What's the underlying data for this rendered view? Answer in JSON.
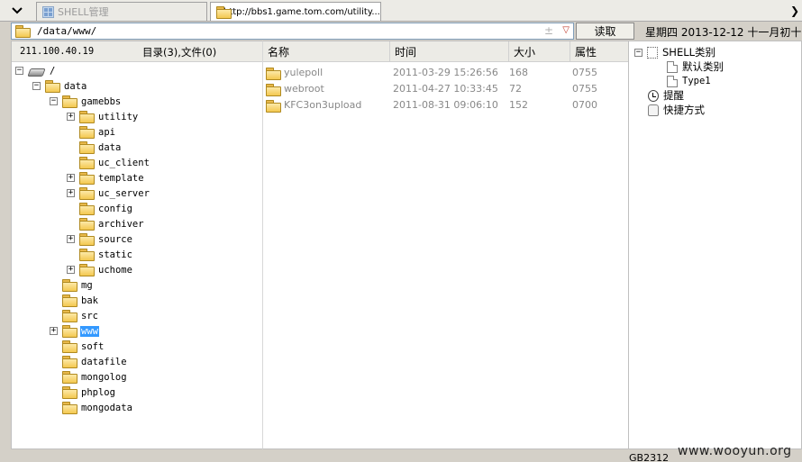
{
  "tabs": [
    {
      "label": "SHELL管理",
      "active": false
    },
    {
      "label": "http://bbs1.game.tom.com/utility...",
      "active": true
    }
  ],
  "address": {
    "path": "/data/www/",
    "read_label": "读取",
    "date": "星期四 2013-12-12 十一月初十"
  },
  "left_header": {
    "ip": "211.100.40.19",
    "summary": "目录(3),文件(0)"
  },
  "tree": {
    "root": "/",
    "data": "data",
    "gamebbs": "gamebbs",
    "gamebbs_children": [
      "utility",
      "api",
      "data",
      "uc_client",
      "template",
      "uc_server",
      "config",
      "archiver",
      "source",
      "static",
      "uchome"
    ],
    "data_children": [
      "mg",
      "bak",
      "src",
      "www",
      "soft",
      "datafile",
      "mongolog",
      "phplog",
      "mongodata"
    ],
    "selected": "www"
  },
  "file_list": {
    "columns": [
      "名称",
      "时间",
      "大小",
      "属性"
    ],
    "rows": [
      {
        "name": "yulepoll",
        "time": "2011-03-29 15:26:56",
        "size": "168",
        "perm": "0755"
      },
      {
        "name": "webroot",
        "time": "2011-04-27 10:33:45",
        "size": "72",
        "perm": "0755"
      },
      {
        "name": "KFC3on3upload",
        "time": "2011-08-31 09:06:10",
        "size": "152",
        "perm": "0700"
      }
    ]
  },
  "right_tree": {
    "shell_category": "SHELL类别",
    "default_category": "默认类别",
    "type1": "Type1",
    "reminder": "提醒",
    "shortcut": "快捷方式"
  },
  "status": {
    "encoding": "GB2312",
    "watermark": "www.wooyun.org"
  }
}
